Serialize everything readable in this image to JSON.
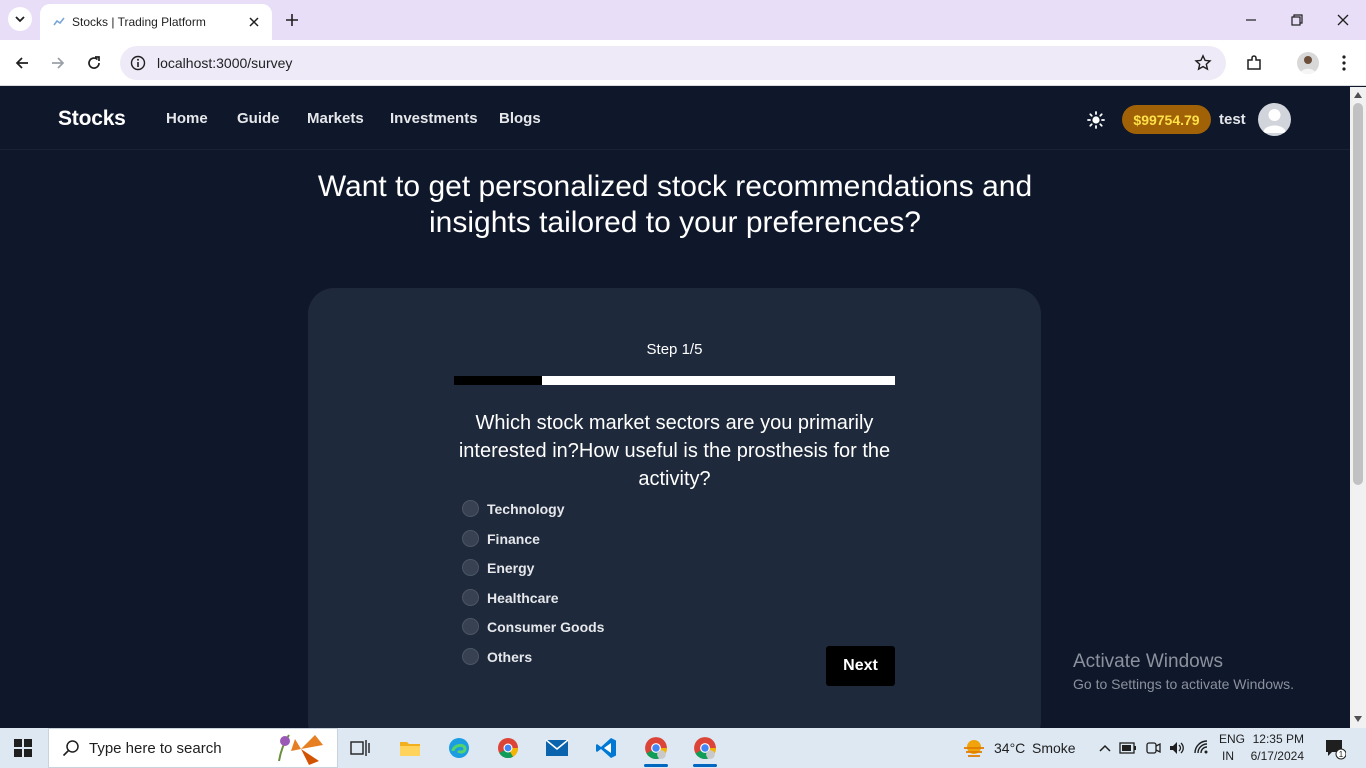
{
  "browser": {
    "tab_title": "Stocks | Trading Platform",
    "url": "localhost:3000/survey"
  },
  "nav": {
    "brand": "Stocks",
    "links": [
      "Home",
      "Guide",
      "Markets",
      "Investments",
      "Blogs"
    ],
    "balance": "$99754.79",
    "username": "test"
  },
  "survey": {
    "headline": "Want to get personalized stock recommendations and insights tailored to your preferences?",
    "step_label": "Step 1/5",
    "progress_fraction": 0.2,
    "question": "Which stock market sectors are you primarily interested in?How useful is the prosthesis for the activity?",
    "options": [
      "Technology",
      "Finance",
      "Energy",
      "Healthcare",
      "Consumer Goods",
      "Others"
    ],
    "next_label": "Next"
  },
  "watermark": {
    "title": "Activate Windows",
    "subtitle": "Go to Settings to activate Windows."
  },
  "taskbar": {
    "search_placeholder": "Type here to search",
    "temperature": "34°C",
    "weather": "Smoke",
    "lang_line1": "ENG",
    "lang_line2": "IN",
    "time": "12:35 PM",
    "date": "6/17/2024",
    "notification_count": "1"
  },
  "colors": {
    "page_bg": "#0f172a",
    "card_bg": "#1e293b",
    "balance_bg": "#a16207",
    "balance_text": "#fde047",
    "tab_strip": "#e8def8"
  }
}
